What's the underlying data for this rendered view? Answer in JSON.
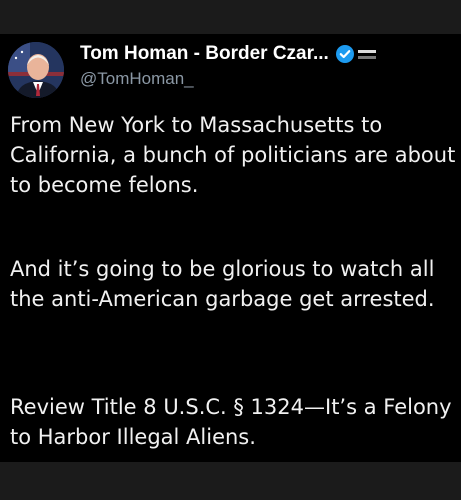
{
  "author": {
    "display_name": "Tom Homan - Border Czar...",
    "handle": "@TomHoman_",
    "verified_color": "#1d9bf0"
  },
  "tweet": {
    "paragraphs": [
      "From New York to Massachusetts to California, a bunch of politicians are about to become felons.",
      "And it’s going to be glorious to watch all the anti-American garbage get arrested.",
      "Review Title 8 U.S.C. § 1324—It’s a Felony to Harbor Illegal Aliens."
    ]
  },
  "icons": {
    "verified": "verified-badge-icon",
    "affiliation": "government-affiliation-icon",
    "avatar": "profile-photo"
  }
}
